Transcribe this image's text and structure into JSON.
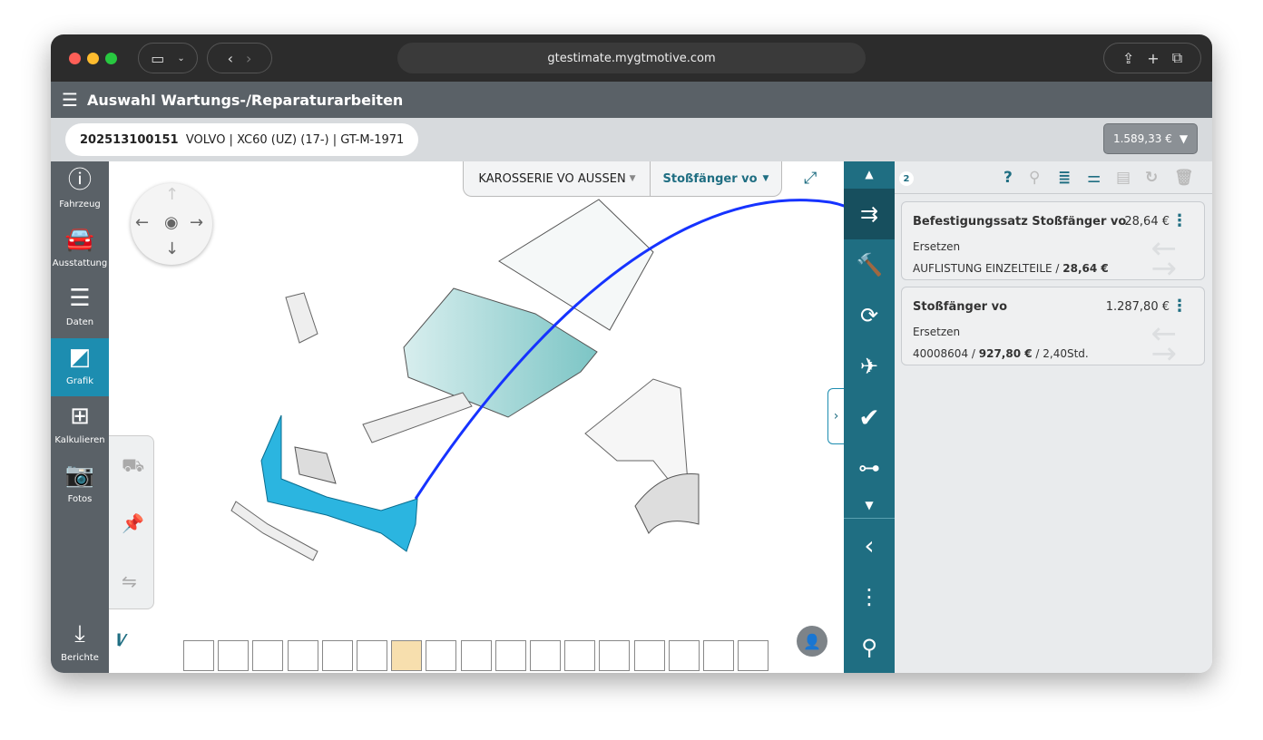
{
  "browser": {
    "url": "gtestimate.mygtmotive.com"
  },
  "header": {
    "title": "Auswahl Wartungs-/Reparaturarbeiten"
  },
  "vehicle": {
    "id": "202513100151",
    "desc": "VOLVO | XC60 (UZ) (17-) | GT-M-1971"
  },
  "total": {
    "amount": "1.589,33 €"
  },
  "sidebar": {
    "items": [
      {
        "label": "Fahrzeug",
        "icon": "info-icon"
      },
      {
        "label": "Ausstattung",
        "icon": "car-icon"
      },
      {
        "label": "Daten",
        "icon": "list-icon"
      },
      {
        "label": "Grafik",
        "icon": "door-icon",
        "active": true
      },
      {
        "label": "Kalkulieren",
        "icon": "calculator-icon"
      },
      {
        "label": "Fotos",
        "icon": "camera-icon"
      },
      {
        "label": "Berichte",
        "icon": "download-icon"
      }
    ]
  },
  "graphic": {
    "group": "KAROSSERIE VO AUSSEN",
    "part": "Stoßfänger vo",
    "thumbnail_count": 17,
    "selected_thumbnail": 6
  },
  "panel": {
    "count": "2",
    "items": [
      {
        "title": "Befestigungssatz Stoßfänger vo",
        "price": "28,64 €",
        "action": "Ersetzen",
        "detail_prefix": "AUFLISTUNG EINZELTEILE / ",
        "detail_bold": "28,64 €",
        "detail_suffix": ""
      },
      {
        "title": "Stoßfänger vo",
        "price": "1.287,80 €",
        "action": "Ersetzen",
        "detail_prefix": "40008604 / ",
        "detail_bold": "927,80 €",
        "detail_suffix": " / 2,40Std."
      }
    ]
  },
  "colors": {
    "accent": "#1d8db0",
    "toolbar": "#1f6e82",
    "highlight": "#2bb5e0"
  }
}
